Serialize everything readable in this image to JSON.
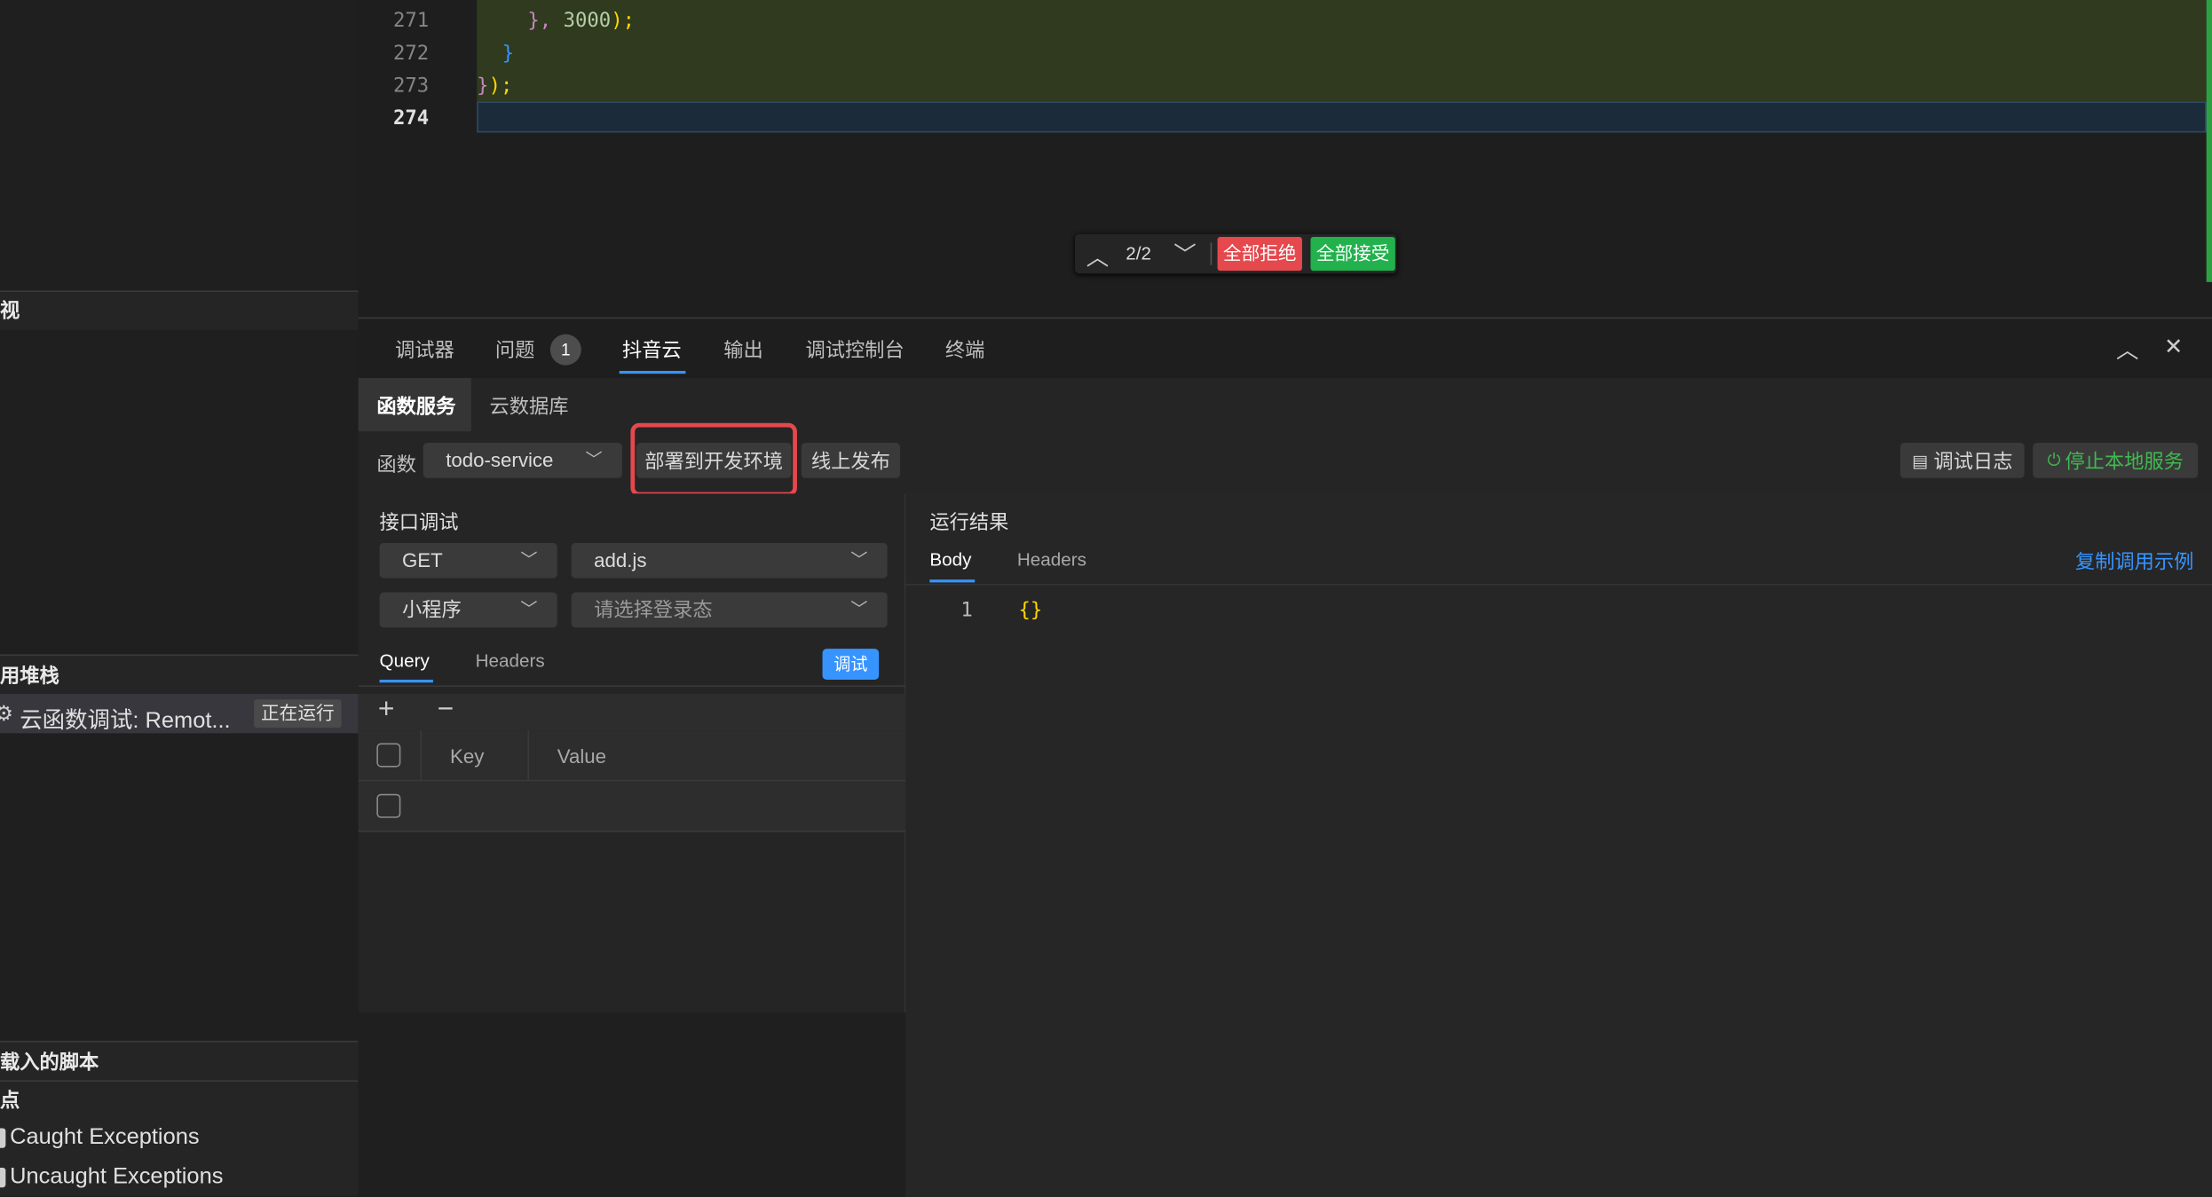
{
  "sidebar": {
    "section_view": "视",
    "section_callstack": "用堆栈",
    "callstack_item_label": "云函数调试: Remot...",
    "callstack_item_status": "正在运行",
    "section_loaded_scripts": "载入的脚本",
    "section_breakpoints": "点",
    "breakpoints": [
      "Caught Exceptions",
      "Uncaught Exceptions"
    ]
  },
  "editor": {
    "line_numbers": [
      "271",
      "272",
      "273",
      "274"
    ],
    "code": {
      "l271_brace": "},",
      "l271_num": " 3000",
      "l271_end": ");",
      "l272": "}",
      "l273_brace": "}",
      "l273_end": ");"
    },
    "diff_nav": {
      "counter": "2/2",
      "reject_all": "全部拒绝",
      "accept_all": "全部接受"
    }
  },
  "panel": {
    "tabs": [
      "调试器",
      "问题",
      "抖音云",
      "输出",
      "调试控制台",
      "终端"
    ],
    "problems_badge": "1",
    "active_tab": "抖音云",
    "subtabs": [
      "函数服务",
      "云数据库"
    ],
    "toolbar": {
      "function_label": "函数",
      "function_value": "todo-service",
      "deploy_dev": "部署到开发环境",
      "publish_online": "线上发布",
      "debug_log": "调试日志",
      "stop_local": "停止本地服务"
    },
    "api_debug": {
      "title": "接口调试",
      "method": "GET",
      "file": "add.js",
      "client": "小程序",
      "login_placeholder": "请选择登录态",
      "tabs": [
        "Query",
        "Headers"
      ],
      "debug_button": "调试",
      "table_headers": [
        "Key",
        "Value"
      ]
    },
    "result": {
      "title": "运行结果",
      "tabs": [
        "Body",
        "Headers"
      ],
      "copy_example": "复制调用示例",
      "body_line_number": "1",
      "body_content": "{}"
    }
  },
  "colors": {
    "reject": "#e5484d",
    "accept": "#22b14c",
    "accent_blue": "#3794ff",
    "highlight_box": "#e5484d"
  }
}
